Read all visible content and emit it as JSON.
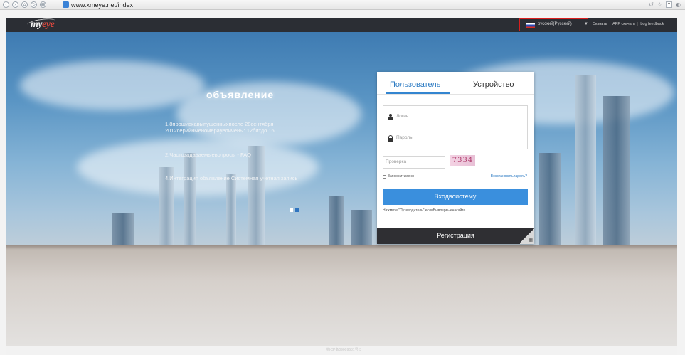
{
  "browser": {
    "url": "www.xmeye.net/index",
    "nav_icons": [
      "back-icon",
      "forward-icon",
      "home-icon",
      "refresh-icon",
      "window-icon"
    ],
    "nav_glyphs": [
      "‹",
      "›",
      "⌂",
      "↻",
      "▦"
    ],
    "right_icons": [
      "reload-icon",
      "star-icon",
      "menu-icon",
      "settings-icon"
    ],
    "right_glyphs": [
      "↺",
      "☆",
      "▾",
      "◐"
    ]
  },
  "header": {
    "logo_main": "my",
    "logo_accent": "eye",
    "language": "русский(Русский)",
    "links": [
      "Скачать",
      "APP скачать",
      "bug feedback"
    ],
    "colors": {
      "bar": "#2b2e34",
      "highlight_border": "#d81e1e"
    }
  },
  "announcement": {
    "title": "объявление",
    "items": [
      "1.8прошивкавыпущенныхпосле 28сентября 2012серийныеномерауеличены: 12битдо 16",
      "2.Частозадаваемыевопросы - FAQ",
      "4.Интеграция объявление Системная учетная запись"
    ]
  },
  "login": {
    "tabs": [
      "Пользователь",
      "Устройство"
    ],
    "active_tab": "Пользователь",
    "login_placeholder": "Логин",
    "password_placeholder": "Пароль",
    "captcha_placeholder": "Проверка",
    "captcha_code": "7334",
    "remember_label": "Запомнитьменя",
    "recover_label": "Восстановитьпароль?",
    "login_button": "Входвсистему",
    "hint": "Нажмите \"Путеводитель\",еслиВывпервыенасайте",
    "register_button": "Регистрация",
    "colors": {
      "accent": "#3a8fdd",
      "register_bg": "#2f2f33"
    }
  },
  "footer": {
    "text": "浙ICP备09009631号-3"
  }
}
